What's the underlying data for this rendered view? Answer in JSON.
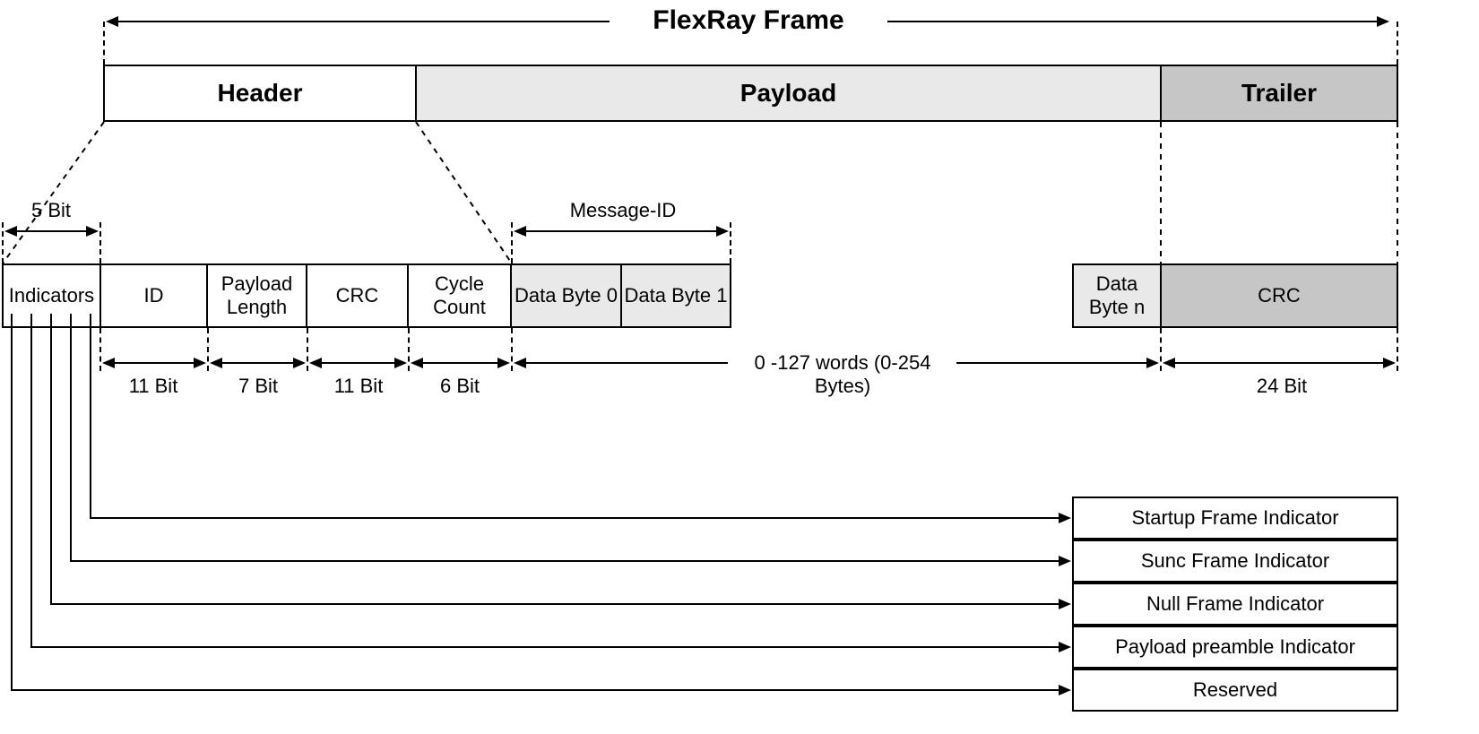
{
  "title": "FlexRay Frame",
  "top_row": {
    "header": "Header",
    "payload": "Payload",
    "trailer": "Trailer"
  },
  "detail_row": {
    "indicators": "Indicators",
    "id": "ID",
    "payload_length": "Payload Length",
    "crc": "CRC",
    "cycle_count": "Cycle Count",
    "data_byte_0": "Data Byte 0",
    "data_byte_1": "Data Byte 1",
    "data_byte_n": "Data Byte n",
    "trailer_crc": "CRC"
  },
  "dims": {
    "five_bit": "5 Bit",
    "message_id": "Message-ID",
    "id_bits": "11 Bit",
    "payload_length_bits": "7 Bit",
    "crc_bits": "11 Bit",
    "cycle_count_bits": "6 Bit",
    "payload_words": "0 -127 words (0-254 Bytes)",
    "trailer_bits": "24 Bit"
  },
  "indicator_names": {
    "i0": "Startup Frame Indicator",
    "i1": "Sunc Frame Indicator",
    "i2": "Null Frame Indicator",
    "i3": "Payload preamble Indicator",
    "i4": "Reserved"
  }
}
